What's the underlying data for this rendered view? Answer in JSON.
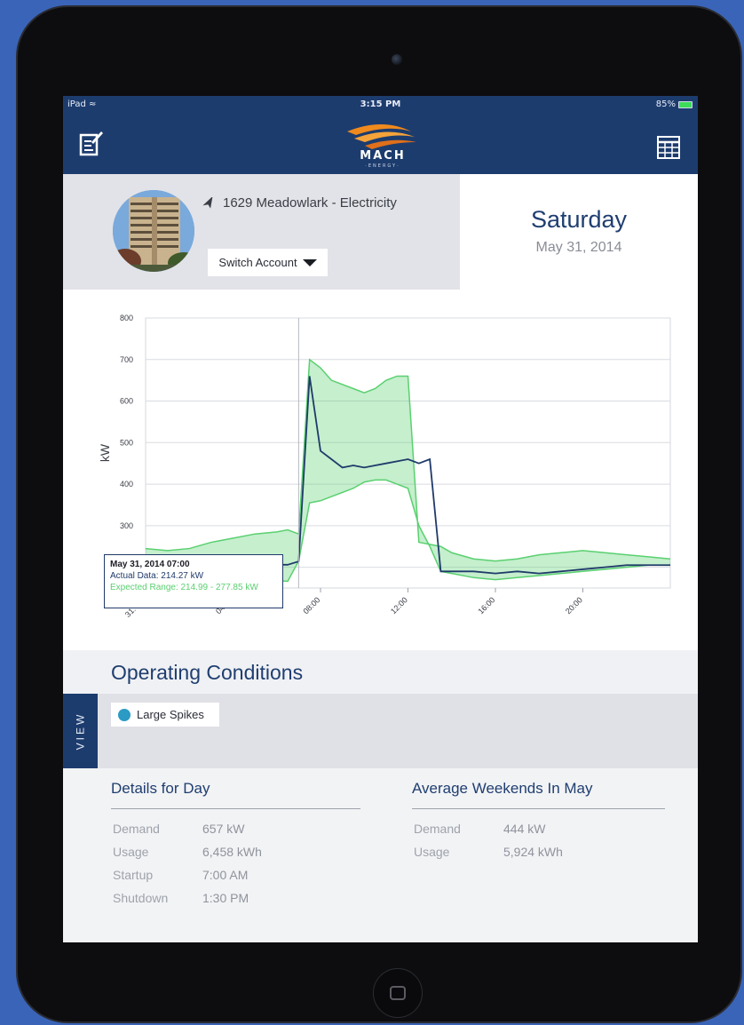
{
  "status_bar": {
    "device": "iPad",
    "time": "3:15 PM",
    "battery": "85%"
  },
  "header": {
    "logo_text": "MACH",
    "logo_sub": "·ENERGY·"
  },
  "account": {
    "name": "1629 Meadowlark - Electricity",
    "switch_label": "Switch Account"
  },
  "date": {
    "day": "Saturday",
    "full": "May 31, 2014"
  },
  "colors": {
    "navy": "#1d3c6e",
    "accent_orange": "#f08a1c",
    "actual_line": "#1f3a6a",
    "expected_band": "#5ad070"
  },
  "chart_data": {
    "type": "line",
    "ylabel": "kW",
    "ylim": [
      150,
      800
    ],
    "yticks": [
      200,
      300,
      400,
      500,
      600,
      700,
      800
    ],
    "xticks": [
      "31. Ma",
      "04:00",
      "08:00",
      "12:00",
      "16:00",
      "20:00"
    ],
    "xtick_hours": [
      0,
      4,
      8,
      12,
      16,
      20
    ],
    "x_hours": [
      0,
      1,
      2,
      3,
      4,
      5,
      6,
      6.5,
      7,
      7.5,
      8,
      8.5,
      9,
      9.5,
      10,
      10.5,
      11,
      11.5,
      12,
      12.5,
      13,
      13.5,
      14,
      15,
      16,
      17,
      18,
      19,
      20,
      21,
      22,
      23,
      24
    ],
    "series": [
      {
        "name": "Actual Data",
        "values": [
          205,
          205,
          206,
          208,
          205,
          205,
          206,
          206,
          214,
          660,
          480,
          460,
          440,
          445,
          440,
          445,
          450,
          455,
          460,
          450,
          460,
          190,
          190,
          190,
          185,
          190,
          185,
          190,
          195,
          200,
          205,
          205,
          205
        ]
      },
      {
        "name": "Expected Range",
        "lower": [
          175,
          175,
          172,
          170,
          168,
          165,
          168,
          166,
          215,
          355,
          360,
          370,
          380,
          390,
          405,
          410,
          410,
          400,
          390,
          300,
          250,
          190,
          185,
          175,
          170,
          175,
          180,
          185,
          190,
          195,
          200,
          205,
          205
        ],
        "upper": [
          245,
          240,
          245,
          260,
          270,
          280,
          285,
          290,
          280,
          700,
          680,
          650,
          640,
          630,
          620,
          630,
          650,
          660,
          660,
          260,
          255,
          250,
          235,
          220,
          215,
          220,
          230,
          235,
          240,
          235,
          230,
          225,
          220
        ]
      }
    ],
    "grid": true,
    "crosshair_hour": 7,
    "tooltip": {
      "date": "May 31, 2014 07:00",
      "actual": "Actual Data: 214.27 kW",
      "expected": "Expected Range: 214.99 - 277.85 kW"
    }
  },
  "operating_conditions": {
    "title": "Operating Conditions",
    "view_label": "VIEW",
    "chip_label": "Large Spikes"
  },
  "details_day": {
    "title": "Details for Day",
    "rows": [
      {
        "key": "Demand",
        "value": "657 kW"
      },
      {
        "key": "Usage",
        "value": "6,458 kWh"
      },
      {
        "key": "Startup",
        "value": "7:00 AM"
      },
      {
        "key": "Shutdown",
        "value": "1:30 PM"
      }
    ]
  },
  "details_avg": {
    "title": "Average Weekends In May",
    "rows": [
      {
        "key": "Demand",
        "value": "444 kW"
      },
      {
        "key": "Usage",
        "value": "5,924 kWh"
      }
    ]
  }
}
